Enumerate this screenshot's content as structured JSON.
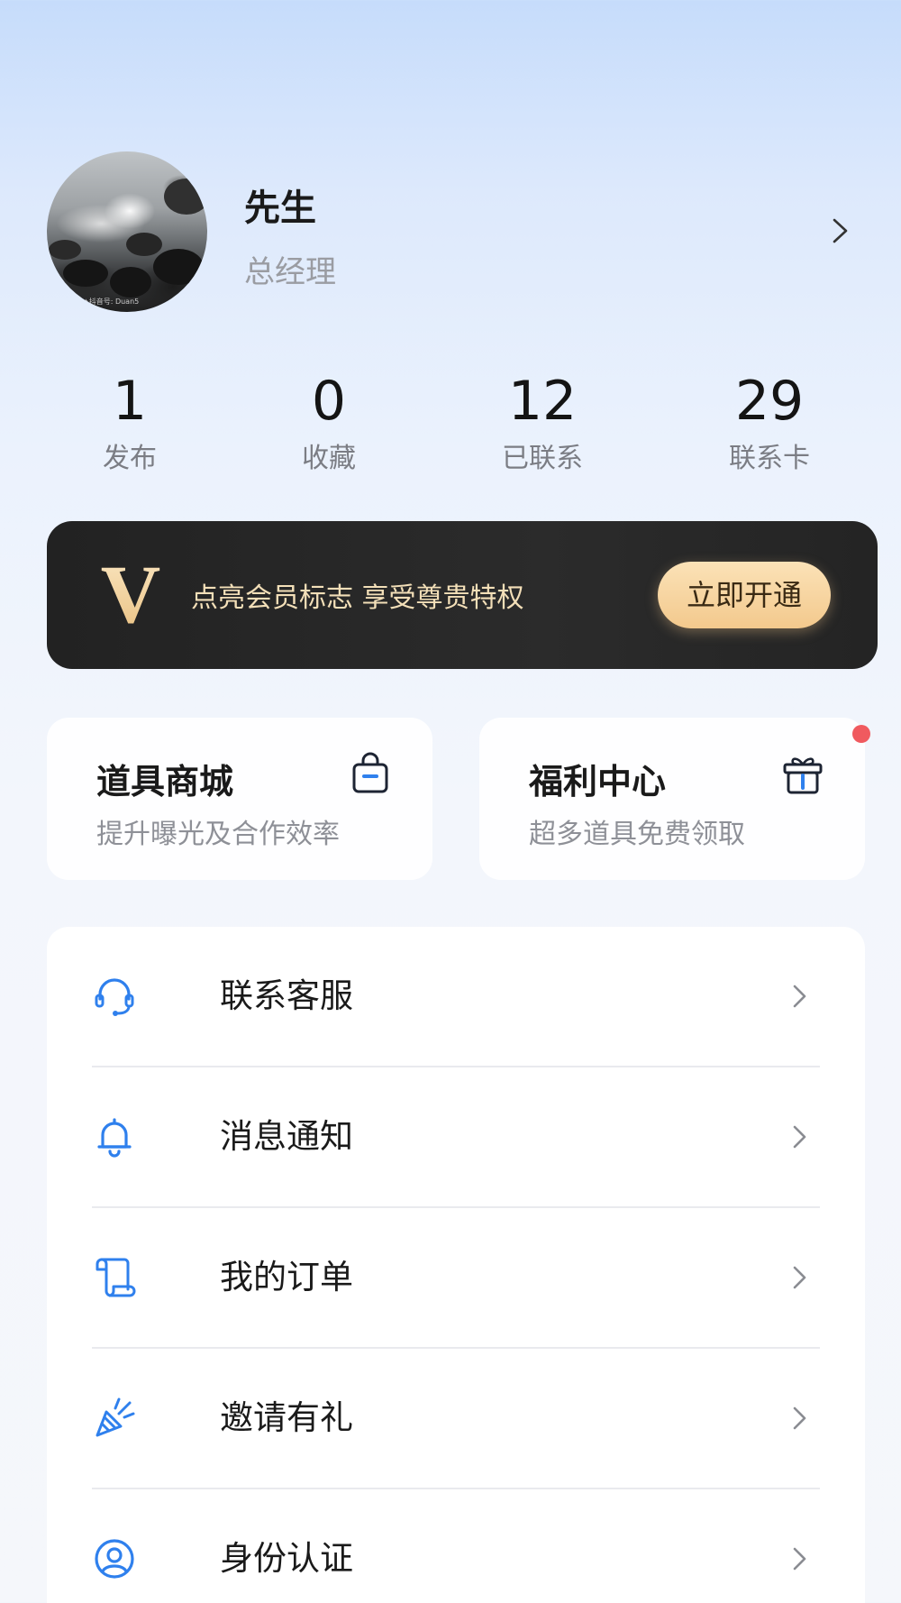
{
  "profile": {
    "name": "先生",
    "title": "总经理",
    "avatar_watermark": "✦抖音号: Duan5"
  },
  "stats": [
    {
      "value": "1",
      "label": "发布"
    },
    {
      "value": "0",
      "label": "收藏"
    },
    {
      "value": "12",
      "label": "已联系"
    },
    {
      "value": "29",
      "label": "联系卡"
    }
  ],
  "vip": {
    "logo_letter": "V",
    "text": "点亮会员标志 享受尊贵特权",
    "button": "立即开通"
  },
  "cards": [
    {
      "title": "道具商城",
      "subtitle": "提升曝光及合作效率",
      "icon": "shopping-bag-icon"
    },
    {
      "title": "福利中心",
      "subtitle": "超多道具免费领取",
      "icon": "gift-icon",
      "badge": "red-dot"
    }
  ],
  "menu": [
    {
      "label": "联系客服",
      "icon": "headset-icon"
    },
    {
      "label": "消息通知",
      "icon": "bell-icon"
    },
    {
      "label": "我的订单",
      "icon": "scroll-order-icon"
    },
    {
      "label": "邀请有礼",
      "icon": "party-popper-icon"
    },
    {
      "label": "身份认证",
      "icon": "user-circle-icon"
    }
  ],
  "colors": {
    "accent_blue": "#2f80ed",
    "vip_gold": "#f3c98d",
    "vip_bg": "#262626",
    "badge_red": "#f05a5f"
  }
}
